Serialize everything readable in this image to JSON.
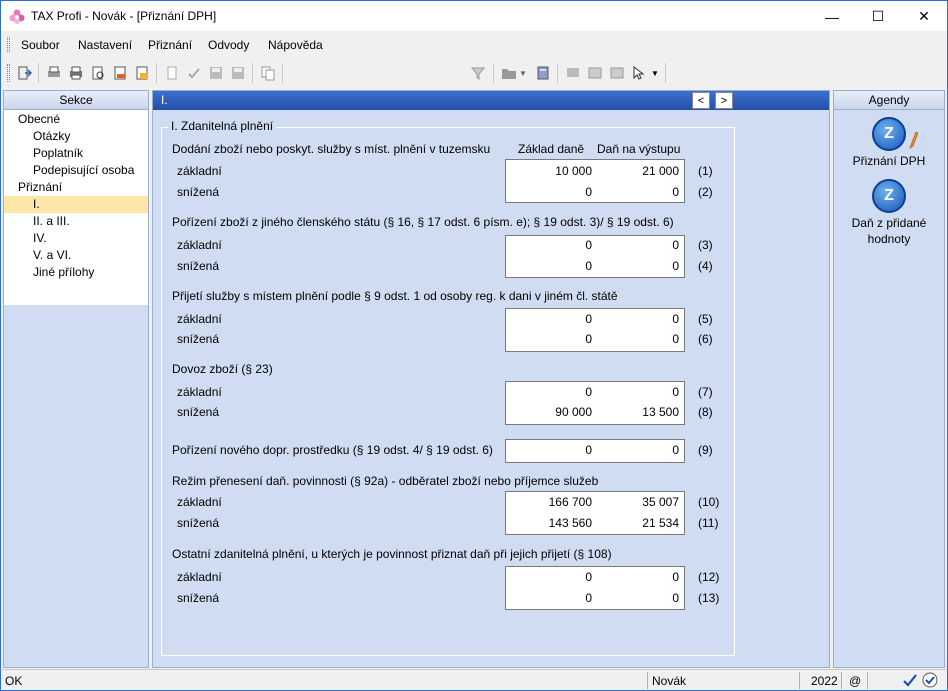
{
  "window": {
    "title": "TAX Profi - Novák - [Přiznání DPH]",
    "min": "—",
    "max": "☐",
    "close": "✕"
  },
  "menu": [
    {
      "label": "Soubor"
    },
    {
      "label": "Nastavení"
    },
    {
      "label": "Přiznání"
    },
    {
      "label": "Odvody"
    },
    {
      "label": "Nápověda"
    }
  ],
  "toolbar": {
    "combo_value": ""
  },
  "left_panel": {
    "header": "Sekce",
    "items": [
      {
        "label": "Obecné",
        "level": 0,
        "selected": false
      },
      {
        "label": "Otázky",
        "level": 1,
        "selected": false
      },
      {
        "label": "Poplatník",
        "level": 1,
        "selected": false
      },
      {
        "label": "Podepisující osoba",
        "level": 1,
        "selected": false
      },
      {
        "label": "Přiznání",
        "level": 0,
        "selected": false
      },
      {
        "label": "I.",
        "level": 1,
        "selected": true
      },
      {
        "label": "II. a III.",
        "level": 1,
        "selected": false
      },
      {
        "label": "IV.",
        "level": 1,
        "selected": false
      },
      {
        "label": "V. a VI.",
        "level": 1,
        "selected": false
      },
      {
        "label": "Jiné přílohy",
        "level": 1,
        "selected": false
      }
    ]
  },
  "center": {
    "header": "I.",
    "prev": "<",
    "next": ">",
    "group_title": "I. Zdanitelná plnění",
    "col_base": "Základ daně",
    "col_tax": "Daň na výstupu",
    "sections": [
      {
        "title": "Dodání zboží nebo poskyt. služby s míst. plnění v tuzemsku",
        "rows": [
          {
            "label": "základní",
            "base": "10 000",
            "tax": "21 000",
            "code": "(1)"
          },
          {
            "label": "snížená",
            "base": "0",
            "tax": "0",
            "code": "(2)"
          }
        ]
      },
      {
        "title": "Pořízení zboží z jiného členského státu (§ 16, § 17 odst. 6 písm. e); § 19 odst. 3)/ § 19 odst. 6)",
        "rows": [
          {
            "label": "základní",
            "base": "0",
            "tax": "0",
            "code": "(3)"
          },
          {
            "label": "snížená",
            "base": "0",
            "tax": "0",
            "code": "(4)"
          }
        ]
      },
      {
        "title": "Přijetí služby s místem plnění podle § 9 odst. 1 od osoby reg. k dani v jiném čl. státě",
        "rows": [
          {
            "label": "základní",
            "base": "0",
            "tax": "0",
            "code": "(5)"
          },
          {
            "label": "snížená",
            "base": "0",
            "tax": "0",
            "code": "(6)"
          }
        ]
      },
      {
        "title": "Dovoz zboží (§ 23)",
        "rows": [
          {
            "label": "základní",
            "base": "0",
            "tax": "0",
            "code": "(7)"
          },
          {
            "label": "snížená",
            "base": "90 000",
            "tax": "13 500",
            "code": "(8)"
          }
        ]
      },
      {
        "title": "Pořízení nového dopr. prostředku (§ 19 odst. 4/ § 19 odst. 6)",
        "rows": [
          {
            "label": "",
            "base": "0",
            "tax": "0",
            "code": "(9)"
          }
        ]
      },
      {
        "title": "Režim přenesení daň. povinnosti (§ 92a) - odběratel zboží nebo příjemce služeb",
        "rows": [
          {
            "label": "základní",
            "base": "166 700",
            "tax": "35 007",
            "code": "(10)"
          },
          {
            "label": "snížená",
            "base": "143 560",
            "tax": "21 534",
            "code": "(11)"
          }
        ]
      },
      {
        "title": "Ostatní zdanitelná plnění, u kterých je povinnost přiznat daň při jejich přijetí (§ 108)",
        "rows": [
          {
            "label": "základní",
            "base": "0",
            "tax": "0",
            "code": "(12)"
          },
          {
            "label": "snížená",
            "base": "0",
            "tax": "0",
            "code": "(13)"
          }
        ]
      }
    ]
  },
  "right_panel": {
    "header": "Agendy",
    "items": [
      {
        "label": "Přiznání DPH"
      },
      {
        "label": "Daň z přidané hodnoty"
      }
    ]
  },
  "status": {
    "left": "OK",
    "user": "Novák",
    "year": "2022",
    "at": "@"
  }
}
